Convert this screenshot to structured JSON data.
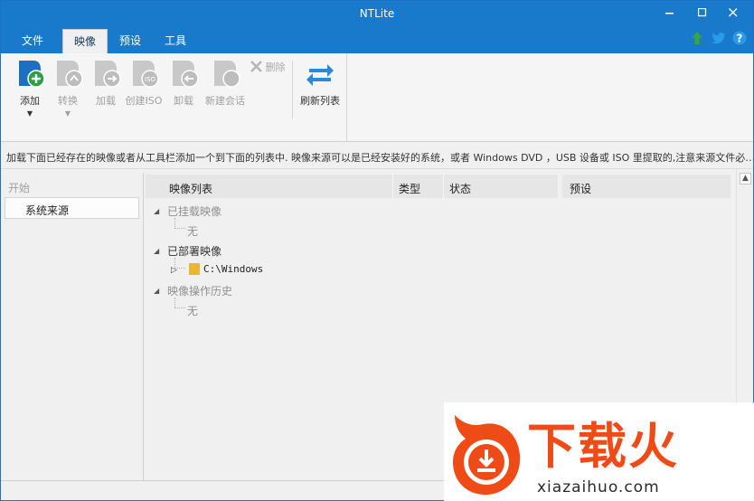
{
  "window": {
    "title": "NTLite"
  },
  "tabs": [
    {
      "label": "文件"
    },
    {
      "label": "映像"
    },
    {
      "label": "预设"
    },
    {
      "label": "工具"
    }
  ],
  "ribbon": {
    "add": "添加",
    "convert": "转换",
    "load": "加载",
    "create_iso": "创建ISO",
    "unload": "卸载",
    "new_session": "新建会话",
    "delete": "删除",
    "refresh": "刷新列表"
  },
  "info": "加载下面已经存在的映像或者从工具栏添加一个到下面的列表中. 映像来源可以是已经安装好的系统，或者 Windows DVD ，USB 设备或 ISO 里提取的,注意来源文件必…",
  "sidebar": {
    "heading": "开始",
    "item": "系统来源"
  },
  "list": {
    "columns": [
      "映像列表",
      "类型",
      "状态"
    ],
    "groups": {
      "mounted": "已挂载映像",
      "mounted_child": "无",
      "deployed": "已部署映像",
      "deployed_child": "C:\\Windows",
      "history": "映像操作历史",
      "history_child": "无"
    }
  },
  "presets": {
    "header": "预设"
  },
  "watermark": {
    "brand": "下载火",
    "domain": "xiazaihuo.com"
  },
  "colors": {
    "titlebar": "#1979ca",
    "accent_orange": "#ee4b16",
    "up_arrow": "#3aa63a",
    "twitter": "#2a9be8"
  }
}
